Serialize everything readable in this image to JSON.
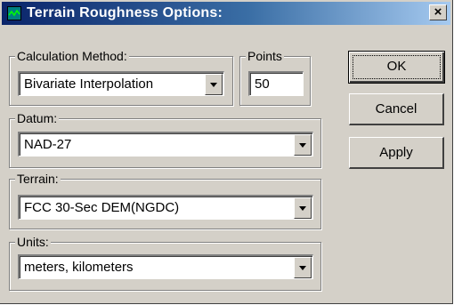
{
  "window": {
    "title": "Terrain Roughness Options:",
    "close_glyph": "×",
    "icon": "terrain-chart-icon"
  },
  "calculation_method": {
    "label": "Calculation Method:",
    "value": "Bivariate Interpolation"
  },
  "points": {
    "label": "Points",
    "value": "50"
  },
  "datum": {
    "label": "Datum:",
    "value": "NAD-27"
  },
  "terrain": {
    "label": "Terrain:",
    "value": "FCC 30-Sec DEM(NGDC)"
  },
  "units": {
    "label": "Units:",
    "value": "meters, kilometers"
  },
  "buttons": {
    "ok": "OK",
    "cancel": "Cancel",
    "apply": "Apply"
  },
  "colors": {
    "dialog_face": "#d4d0c8",
    "titlebar_start": "#0a246a",
    "titlebar_end": "#a6caf0"
  }
}
